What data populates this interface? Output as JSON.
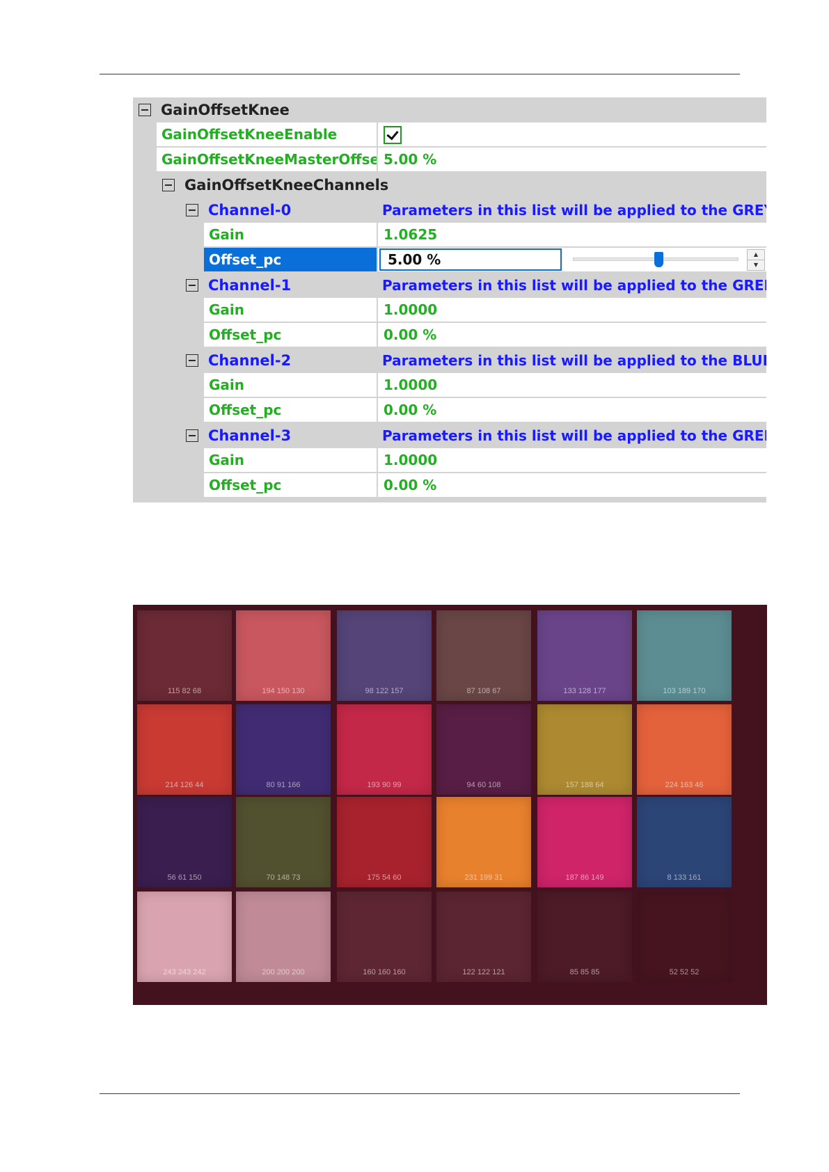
{
  "property_grid": {
    "category": {
      "label": "GainOffsetKnee"
    },
    "enable": {
      "name": "GainOffsetKneeEnable",
      "checked": true
    },
    "master_offset": {
      "name": "GainOffsetKneeMasterOffset_",
      "value": "5.00 %"
    },
    "channels_category": {
      "label": "GainOffsetKneeChannels"
    },
    "channels": [
      {
        "label": "Channel-0",
        "description": "Parameters in this list will be applied to the GREY chann",
        "gain_name": "Gain",
        "gain_value": "1.0625",
        "offset_name": "Offset_pc",
        "offset_value": "5.00 %",
        "offset_slider_fraction": 0.52
      },
      {
        "label": "Channel-1",
        "description": "Parameters in this list will be applied to the GREEN chan",
        "gain_name": "Gain",
        "gain_value": "1.0000",
        "offset_name": "Offset_pc",
        "offset_value": "0.00 %"
      },
      {
        "label": "Channel-2",
        "description": "Parameters in this list will be applied to the BLUE chann",
        "gain_name": "Gain",
        "gain_value": "1.0000",
        "offset_name": "Offset_pc",
        "offset_value": "0.00 %"
      },
      {
        "label": "Channel-3",
        "description": "Parameters in this list will be applied to the GREEN chan",
        "gain_name": "Gain",
        "gain_value": "1.0000",
        "offset_name": "Offset_pc",
        "offset_value": "0.00 %"
      }
    ],
    "colors": {
      "category_bg": "#d3d3d3",
      "value_green": "#22b022",
      "channel_blue": "#1a1aff",
      "selection_blue": "#0a6fd8"
    }
  },
  "color_chart": {
    "background": "#43121e",
    "patches": [
      [
        {
          "label": "115 82 68",
          "color": "#6b2a35"
        },
        {
          "label": "194 150 130",
          "color": "#c8575f"
        },
        {
          "label": "98 122 157",
          "color": "#544477"
        },
        {
          "label": "87 108 67",
          "color": "#6a4646"
        },
        {
          "label": "133 128 177",
          "color": "#6a4489"
        },
        {
          "label": "103 189 170",
          "color": "#5c8d92"
        }
      ],
      [
        {
          "label": "214 126 44",
          "color": "#c93a33"
        },
        {
          "label": "80 91 166",
          "color": "#412c73"
        },
        {
          "label": "193 90 99",
          "color": "#c42848"
        },
        {
          "label": "94 60 108",
          "color": "#581e45"
        },
        {
          "label": "157 188 64",
          "color": "#ad8a31"
        },
        {
          "label": "224 163 46",
          "color": "#e4623b"
        }
      ],
      [
        {
          "label": "56 61 150",
          "color": "#3a1e4f"
        },
        {
          "label": "70 148 73",
          "color": "#51502f"
        },
        {
          "label": "175 54 60",
          "color": "#a7222d"
        },
        {
          "label": "231 199 31",
          "color": "#e8812d"
        },
        {
          "label": "187 86 149",
          "color": "#cf2468"
        },
        {
          "label": "8 133 161",
          "color": "#2c4577"
        }
      ],
      [
        {
          "label": "243 243 242",
          "color": "#d9a4b0"
        },
        {
          "label": "200 200 200",
          "color": "#c08a97"
        },
        {
          "label": "160 160 160",
          "color": "#5e2633"
        },
        {
          "label": "122 122 121",
          "color": "#5b2531"
        },
        {
          "label": "85 85 85",
          "color": "#4d1a27"
        },
        {
          "label": "52 52 52",
          "color": "#46141f"
        }
      ]
    ]
  }
}
